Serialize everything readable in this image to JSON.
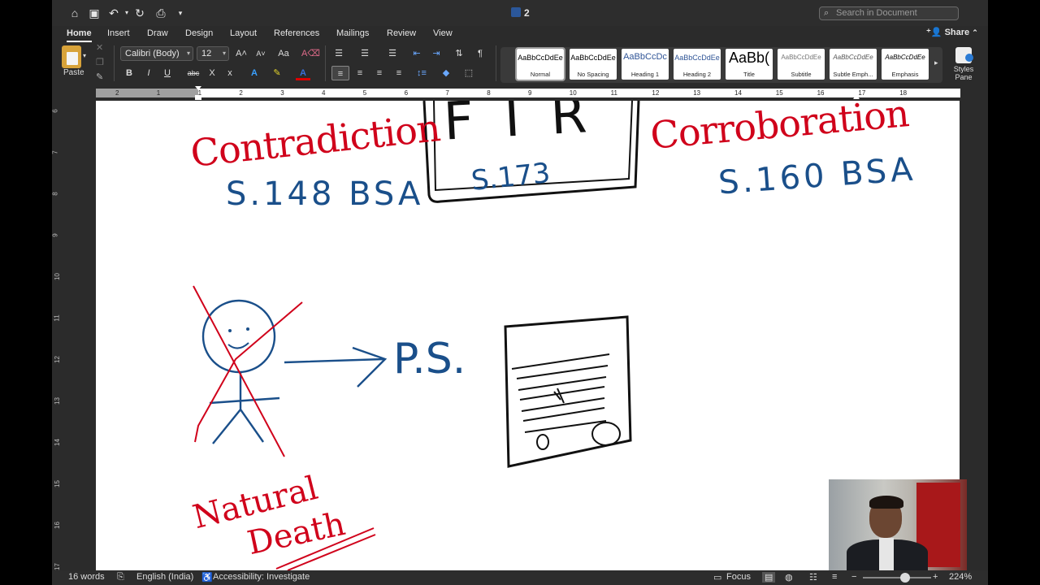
{
  "titlebar": {
    "doc_title": "2",
    "search_placeholder": "Search in Document"
  },
  "tabs": [
    "Home",
    "Insert",
    "Draw",
    "Design",
    "Layout",
    "References",
    "Mailings",
    "Review",
    "View"
  ],
  "share_label": "Share",
  "ribbon": {
    "paste_label": "Paste",
    "font_name": "Calibri (Body)",
    "font_size": "12",
    "styles": [
      {
        "sample": "AaBbCcDdEe",
        "name": "Normal"
      },
      {
        "sample": "AaBbCcDdEe",
        "name": "No Spacing"
      },
      {
        "sample": "AaBbCcDc",
        "name": "Heading 1"
      },
      {
        "sample": "AaBbCcDdEe",
        "name": "Heading 2"
      },
      {
        "sample": "AaBb(",
        "name": "Title"
      },
      {
        "sample": "AaBbCcDdEe",
        "name": "Subtitle"
      },
      {
        "sample": "AaBbCcDdEe",
        "name": "Subtle Emph..."
      },
      {
        "sample": "AaBbCcDdEe",
        "name": "Emphasis"
      }
    ],
    "styles_pane_label": "Styles Pane"
  },
  "ruler": {
    "numbers": [
      "2",
      "1",
      "1",
      "2",
      "3",
      "4",
      "5",
      "6",
      "7",
      "8",
      "9",
      "10",
      "11",
      "12",
      "13",
      "14",
      "15",
      "16",
      "17",
      "18"
    ]
  },
  "vruler": {
    "numbers": [
      "6",
      "7",
      "8",
      "9",
      "10",
      "11",
      "12",
      "13",
      "14",
      "15",
      "16",
      "17"
    ]
  },
  "page": {
    "left_word": "Contradiction",
    "left_section": "S.148 BSA",
    "center_box": "FIR",
    "center_section": "S.173",
    "right_word": "Corroboration",
    "right_section": "S.160 BSA",
    "ps_label": "P.S.",
    "natural_death": [
      "Natural",
      "Death"
    ]
  },
  "status": {
    "words": "16 words",
    "language": "English (India)",
    "accessibility": "Accessibility: Investigate",
    "focus": "Focus",
    "zoom": "224%"
  },
  "colors": {
    "ink_red": "#d0021b",
    "ink_blue": "#1a4f8a",
    "ink_black": "#111111"
  }
}
